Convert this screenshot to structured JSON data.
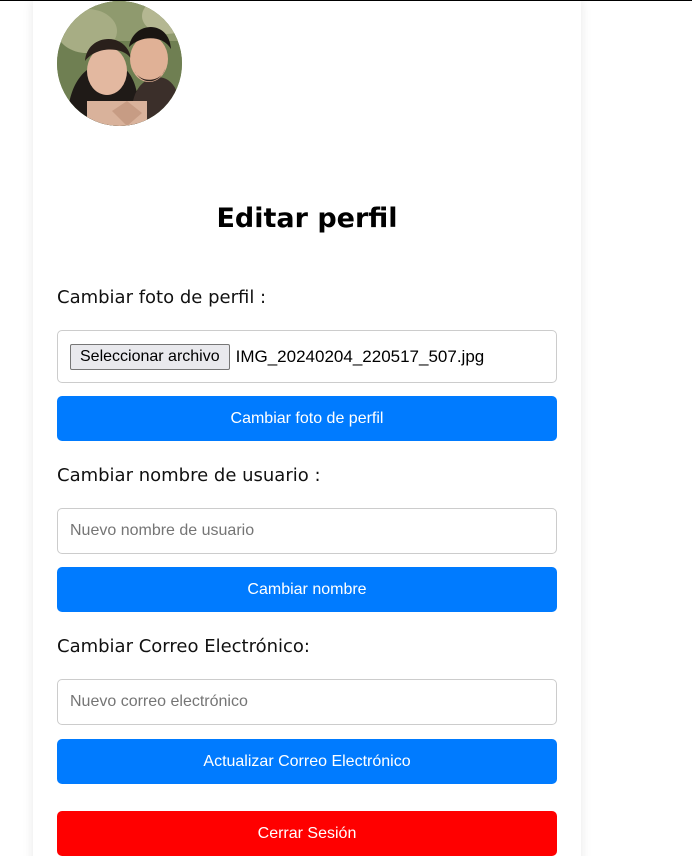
{
  "profile": {
    "title": "Editar perfil",
    "photo_section": {
      "label": "Cambiar foto de perfil :",
      "file_button_label": "Seleccionar archivo",
      "file_name": "IMG_20240204_220517_507.jpg",
      "submit_label": "Cambiar foto de perfil"
    },
    "username_section": {
      "label": "Cambiar nombre de usuario :",
      "placeholder": "Nuevo nombre de usuario",
      "submit_label": "Cambiar nombre"
    },
    "email_section": {
      "label": "Cambiar Correo Electrónico:",
      "placeholder": "Nuevo correo electrónico",
      "submit_label": "Actualizar Correo Electrónico"
    },
    "logout_label": "Cerrar Sesión"
  },
  "colors": {
    "primary": "#007bff",
    "danger": "#ff0000"
  }
}
